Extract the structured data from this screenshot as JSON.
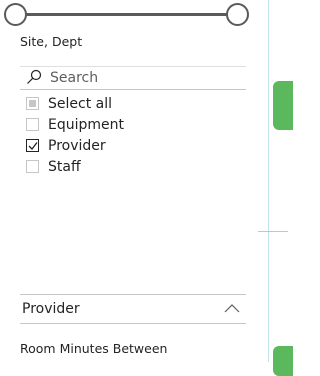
{
  "slicer": {
    "title": "Site, Dept"
  },
  "search": {
    "placeholder": "Search"
  },
  "items": [
    {
      "label": "Select all",
      "state": "partial"
    },
    {
      "label": "Equipment",
      "state": "unchecked"
    },
    {
      "label": "Provider",
      "state": "checked"
    },
    {
      "label": "Staff",
      "state": "unchecked"
    }
  ],
  "dropdown": {
    "value": "Provider"
  },
  "next_section": {
    "label": "Room Minutes Between"
  },
  "colors": {
    "accent": "#5cb85c",
    "divider": "#bfe3ee",
    "text": "#252423"
  }
}
